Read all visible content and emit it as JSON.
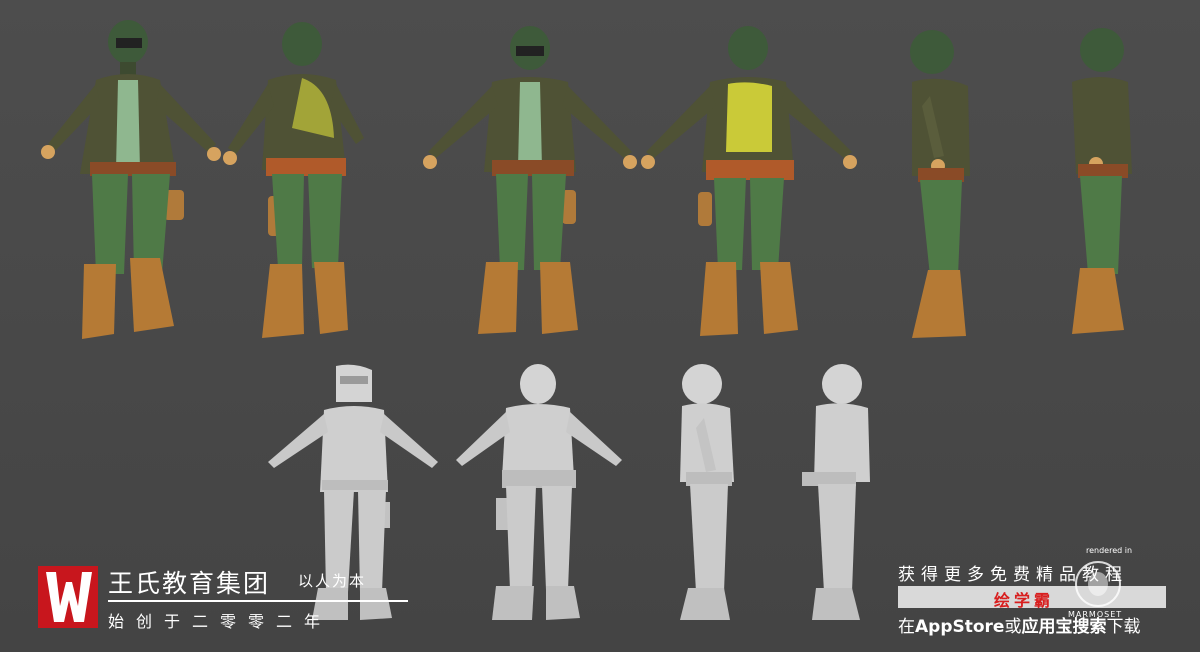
{
  "brand": {
    "name": "王氏教育集团",
    "slogan": "以人为本",
    "founded": "始创于二零零二年"
  },
  "promo": {
    "line1": "获得更多免费精品教程",
    "app_name": "绘学霸",
    "line3_prefix": "在",
    "line3_store": "AppStore",
    "line3_or": "或",
    "line3_market": "应用宝搜索",
    "line3_suffix": "下载"
  },
  "watermark": {
    "rendered_in": "rendered in",
    "name": "MARMOSET"
  },
  "colors": {
    "background": "#4a4a4a",
    "logo_red": "#c8161d",
    "jacket": "#4f5235",
    "shirt": "#8fb78f",
    "pants": "#4f7a47",
    "boots": "#b57a35",
    "helmet": "#3e5a3a",
    "yellow_paint": "#e8e83a",
    "clay": "#cfcfcf",
    "app_red": "#d81e1e"
  }
}
